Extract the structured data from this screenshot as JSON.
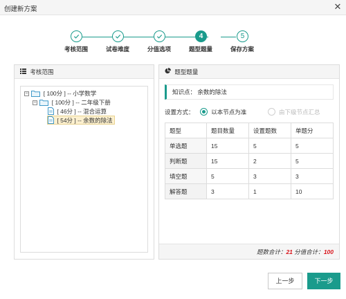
{
  "window": {
    "title": "创建新方案",
    "close_glyph": "✕"
  },
  "steps": [
    {
      "number": "1",
      "label": "考核范围",
      "state": "done"
    },
    {
      "number": "2",
      "label": "试卷难度",
      "state": "done"
    },
    {
      "number": "3",
      "label": "分值选项",
      "state": "done"
    },
    {
      "number": "4",
      "label": "题型题量",
      "state": "active"
    },
    {
      "number": "5",
      "label": "保存方案",
      "state": "pending"
    }
  ],
  "left_panel": {
    "title": "考核范围",
    "icon": "list-icon",
    "tree": [
      {
        "toggle": "−",
        "text": "[ 100分 ] -- 小学数学",
        "type": "folder"
      },
      {
        "toggle": "−",
        "text": "[ 100分 ] -- 二年级下册",
        "type": "folder"
      },
      {
        "toggle": "",
        "text": "[ 46分 ] -- 混合运算",
        "type": "file"
      },
      {
        "toggle": "",
        "text": "[ 54分 ] -- 余数的除法",
        "type": "file",
        "selected": true
      }
    ]
  },
  "right_panel": {
    "title": "题型题量",
    "icon": "pie-chart-icon",
    "knowledge_point": "知识点： 余数的除法",
    "setting_label": "设置方式：",
    "option_selected": "以本节点为准",
    "option_disabled": "由下级节点汇总",
    "table": {
      "headers": [
        "题型",
        "题目数量",
        "设置题数",
        "单题分"
      ],
      "rows": [
        [
          "单选题",
          "15",
          "5",
          "5"
        ],
        [
          "判断题",
          "15",
          "2",
          "5"
        ],
        [
          "填空题",
          "5",
          "3",
          "3"
        ],
        [
          "解答题",
          "3",
          "1",
          "10"
        ]
      ]
    },
    "summary": {
      "count_label": "题数合计：",
      "count_value": "21",
      "score_label": "分值合计：",
      "score_value": "100"
    }
  },
  "buttons": {
    "prev": "上一步",
    "next": "下一步"
  },
  "colors": {
    "accent": "#1a9b8c",
    "highlight": "#d9161d"
  }
}
